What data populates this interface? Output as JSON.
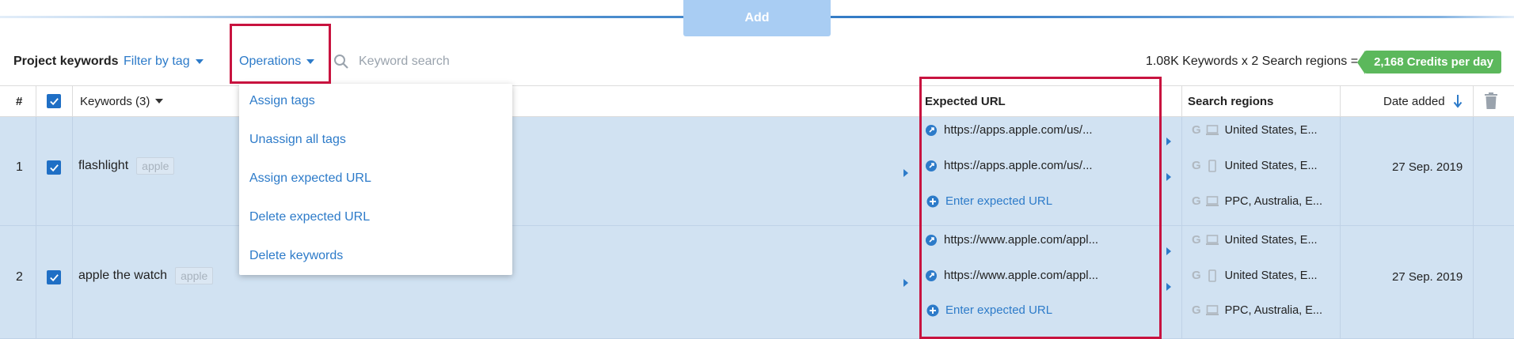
{
  "top": {
    "add_label": "Add"
  },
  "toolbar": {
    "title": "Project keywords",
    "filter_label": "Filter by tag",
    "operations_label": "Operations",
    "search_placeholder": "Keyword search",
    "summary": "1.08K Keywords x 2 Search regions =",
    "credits": "2,168 Credits per day"
  },
  "menu": {
    "items": [
      "Assign tags",
      "Unassign all tags",
      "Assign expected URL",
      "Delete expected URL",
      "Delete keywords"
    ]
  },
  "table": {
    "headers": {
      "num": "#",
      "keywords": "Keywords (3)",
      "expected_url": "Expected URL",
      "search_regions": "Search regions",
      "date_added": "Date added"
    },
    "rows": [
      {
        "num": "1",
        "keyword": "flashlight",
        "tag": "apple",
        "urls": [
          "https://apps.apple.com/us/...",
          "https://apps.apple.com/us/..."
        ],
        "enter_label": "Enter expected URL",
        "regions": [
          "United States, E...",
          "United States, E...",
          "PPC, Australia, E..."
        ],
        "date": "27 Sep. 2019"
      },
      {
        "num": "2",
        "keyword": "apple the watch",
        "tag": "apple",
        "urls": [
          "https://www.apple.com/appl...",
          "https://www.apple.com/appl..."
        ],
        "enter_label": "Enter expected URL",
        "regions": [
          "United States, E...",
          "United States, E...",
          "PPC, Australia, E..."
        ],
        "date": "27 Sep. 2019"
      }
    ]
  },
  "colors": {
    "accent": "#2d7bc9",
    "row_selected": "#d1e2f2",
    "highlight": "#c8133f",
    "credits": "#5cb85c"
  }
}
